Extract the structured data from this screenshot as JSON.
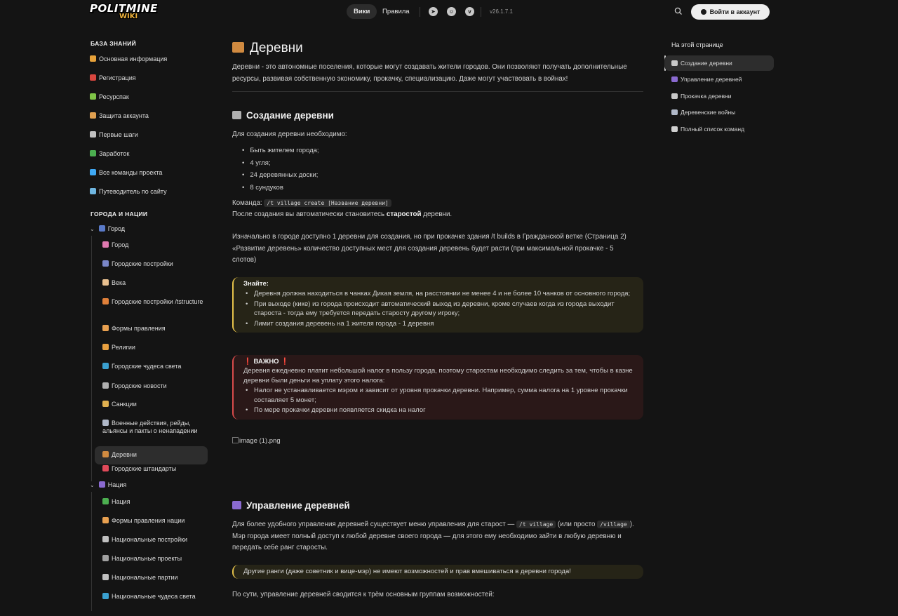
{
  "header": {
    "logo_main": "POLITMINE",
    "logo_sub": "WIKI",
    "nav": [
      "Вики",
      "Правила"
    ],
    "version": "v26.1.7.1",
    "login": "Войти в аккаунт"
  },
  "sidebar": {
    "section1": "БАЗА ЗНАНИЙ",
    "items1": [
      {
        "label": "Основная информация",
        "color": "#e8a23a"
      },
      {
        "label": "Регистрация",
        "color": "#d9473f"
      },
      {
        "label": "Ресурспак",
        "color": "#7fc447"
      },
      {
        "label": "Защита аккаунта",
        "color": "#e0a050"
      },
      {
        "label": "Первые шаги",
        "color": "#c0c0c0"
      },
      {
        "label": "Заработок",
        "color": "#4caf50"
      },
      {
        "label": "Все команды проекта",
        "color": "#3fa9f5"
      },
      {
        "label": "Путеводитель по сайту",
        "color": "#6fb6e0"
      }
    ],
    "section2": "ГОРОДА И НАЦИИ",
    "group_city": "Город",
    "city_items": [
      {
        "label": "Город",
        "color": "#e07ab0"
      },
      {
        "label": "Городские постройки",
        "color": "#7a86c8"
      },
      {
        "label": "Века",
        "color": "#e8c090"
      },
      {
        "label": "Городские постройки /tstructure",
        "color": "#e0803a"
      },
      {
        "label": "Формы правления",
        "color": "#e8a050"
      },
      {
        "label": "Религии",
        "color": "#e8a040"
      },
      {
        "label": "Городские чудеса света",
        "color": "#3aa0d0"
      },
      {
        "label": "Городские новости",
        "color": "#b0b0b0"
      },
      {
        "label": "Санкции",
        "color": "#e0b050"
      },
      {
        "label": "Военные действия, рейды, альянсы и пакты о ненападении",
        "color": "#b0b8c8"
      },
      {
        "label": "Деревни",
        "color": "#d08a40"
      },
      {
        "label": "Городские штандарты",
        "color": "#e04a5a"
      }
    ],
    "group_nation": "Нация",
    "nation_items": [
      {
        "label": "Нация",
        "color": "#4caf50"
      },
      {
        "label": "Формы правления нации",
        "color": "#e8a050"
      },
      {
        "label": "Национальные постройки",
        "color": "#c0c0c0"
      },
      {
        "label": "Национальные проекты",
        "color": "#a0a0a0"
      },
      {
        "label": "Национальные партии",
        "color": "#c0c0c0"
      },
      {
        "label": "Национальные чудеса света",
        "color": "#3aa0d0"
      }
    ]
  },
  "main": {
    "title": "Деревни",
    "intro": "Деревни - это автономные поселения, которые могут создавать жители городов. Они позволяют получать дополнительные ресурсы, развивая собственную экономику, прокачку, специализацию. Даже могут участвовать в войнах!",
    "h_create": "Создание деревни",
    "need": "Для создания деревни необходимо:",
    "req": [
      "Быть жителем города;",
      "4 угля;",
      "24 деревянных доски;",
      "8 сундуков"
    ],
    "cmd_label": "Команда:",
    "cmd": "/t village create [Название деревни]",
    "after_a": "После создания вы автоматически становитесь ",
    "after_b": "старостой",
    "after_c": " деревни.",
    "slots": "Изначально в городе доступно 1 деревни для создания, но при прокачке здания /t builds в Гражданской ветке (Страница 2) «Развитие деревень» количество доступных мест для создания деревень будет расти (при максимальной прокачке - 5 слотов)",
    "know_title": "Знайте:",
    "know": [
      "Деревня должна находиться в чанках Дикая земля, на расстоянии не менее 4 и не более 10 чанков от основного города;",
      "При выходе (кике) из города происходит автоматический выход из деревни, кроме случаев когда из города выходит староста - тогда ему требуется передать старосту другому игроку;",
      "Лимит создания деревень на 1 жителя города - 1 деревня"
    ],
    "important_title": "ВАЖНО",
    "important_body": "Деревня ежедневно платит небольшой налог в пользу города, поэтому старостам необходимо следить за тем, чтобы в казне деревни были деньги на уплату этого налога:",
    "important": [
      "Налог не устанавливается мэром и зависит от уровня прокачки деревни. Например, сумма налога на 1 уровне прокачки составляет 5 монет;",
      "По мере прокачки деревни появляется скидка на налог"
    ],
    "img_alt": "image (1).png",
    "h_manage": "Управление деревней",
    "manage_a": "Для более удобного управления деревней существует меню управления для старост — ",
    "manage_cmd1": "/t village",
    "manage_b": " (или просто ",
    "manage_cmd2": "/village",
    "manage_c": "). Мэр города имеет полный доступ к любой деревне своего города — для этого ему необходимо зайти в любую деревню и передать себе ранг старосты.",
    "other_ranks": "Другие ранги (даже советник и вице-мэр) не имеют возможностей и прав вмешиваться в деревни города!",
    "groups": "По сути, управление деревней сводится к трём основным группам возможностей:"
  },
  "toc": {
    "title": "На этой странице",
    "items": [
      {
        "label": "Создание деревни",
        "color": "#c8c8c8"
      },
      {
        "label": "Управление деревней",
        "color": "#8a6ad0"
      },
      {
        "label": "Прокачка деревни",
        "color": "#c8c8c8"
      },
      {
        "label": "Деревенские войны",
        "color": "#b0b8c8"
      },
      {
        "label": "Полный список команд",
        "color": "#d0d0d0"
      }
    ]
  }
}
